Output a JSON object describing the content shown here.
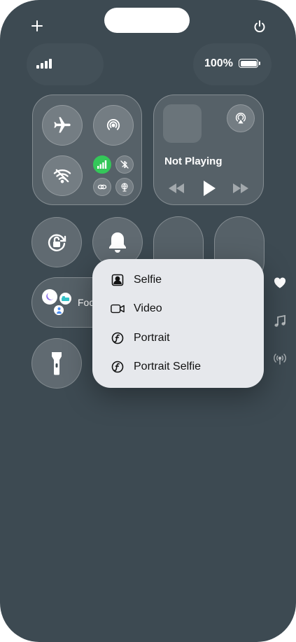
{
  "status": {
    "battery_percent": "100%",
    "battery_level": 1.0,
    "signal_bars": 4
  },
  "media": {
    "title": "Not Playing"
  },
  "focus": {
    "label_partial": "Foc"
  },
  "camera_menu": {
    "items": [
      {
        "label": "Selfie",
        "icon": "portrait-frame-icon"
      },
      {
        "label": "Video",
        "icon": "video-camera-icon"
      },
      {
        "label": "Portrait",
        "icon": "aperture-f-icon"
      },
      {
        "label": "Portrait Selfie",
        "icon": "aperture-f-icon"
      }
    ]
  },
  "colors": {
    "background": "#3d4a52",
    "cellular_active": "#34c759",
    "menu_background": "#e6e8ec"
  }
}
